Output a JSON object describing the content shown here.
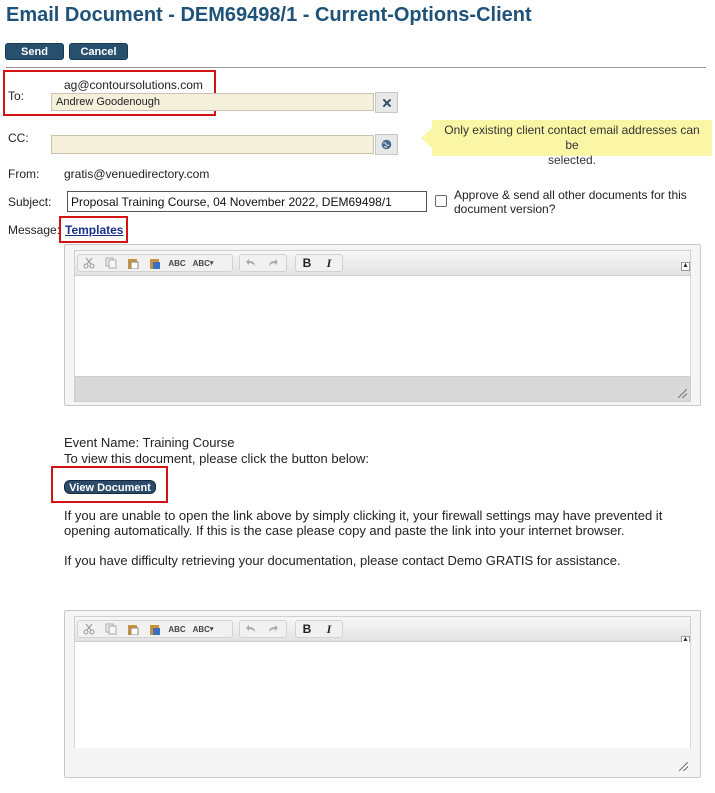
{
  "page": {
    "title": "Email Document - DEM69498/1 - Current-Options-Client"
  },
  "actions": {
    "send_label": "Send",
    "cancel_label": "Cancel"
  },
  "form": {
    "to_label": "To:",
    "to_email": "ag@contoursolutions.com",
    "to_name": "Andrew Goodenough",
    "cc_label": "CC:",
    "cc_value": "",
    "cc_tip_line1": "Only existing client contact email addresses can be",
    "cc_tip_line2": "selected.",
    "from_label": "From:",
    "from_value": "gratis@venuedirectory.com",
    "subject_label": "Subject:",
    "subject_value": "Proposal Training Course, 04 November 2022, DEM69498/1",
    "approve_line1": "Approve & send all other documents for this",
    "approve_line2": "document version?",
    "approve_checked": false,
    "message_label": "Message:",
    "templates_link": "Templates"
  },
  "editor_toolbar": {
    "buttons": [
      "cut-icon",
      "copy-icon",
      "paste-icon",
      "paste-word-icon",
      "spellcheck-icon",
      "spellcheck-dropdown-icon",
      "undo-icon",
      "redo-icon",
      "bold-icon",
      "italic-icon"
    ],
    "spell_text": "ABC",
    "bold_text": "B",
    "italic_text": "I"
  },
  "message_body": {
    "event_name": "Event Name: Training Course",
    "view_instruction": "To view this document, please click the button below:",
    "view_button": "View Document",
    "firewall_line1": "If you are unable to open the link above by simply clicking it, your firewall settings may have prevented it",
    "firewall_line2": "opening automatically. If this is the case please copy and paste the link into your internet browser.",
    "difficulty": "If you have difficulty retrieving your documentation, please contact Demo GRATIS for assistance."
  },
  "colors": {
    "title": "#1f5278",
    "button": "#27506e",
    "highlight_border": "#d11414",
    "field_bg": "#f5f0dc",
    "tip_bg": "#fbf6a6"
  }
}
